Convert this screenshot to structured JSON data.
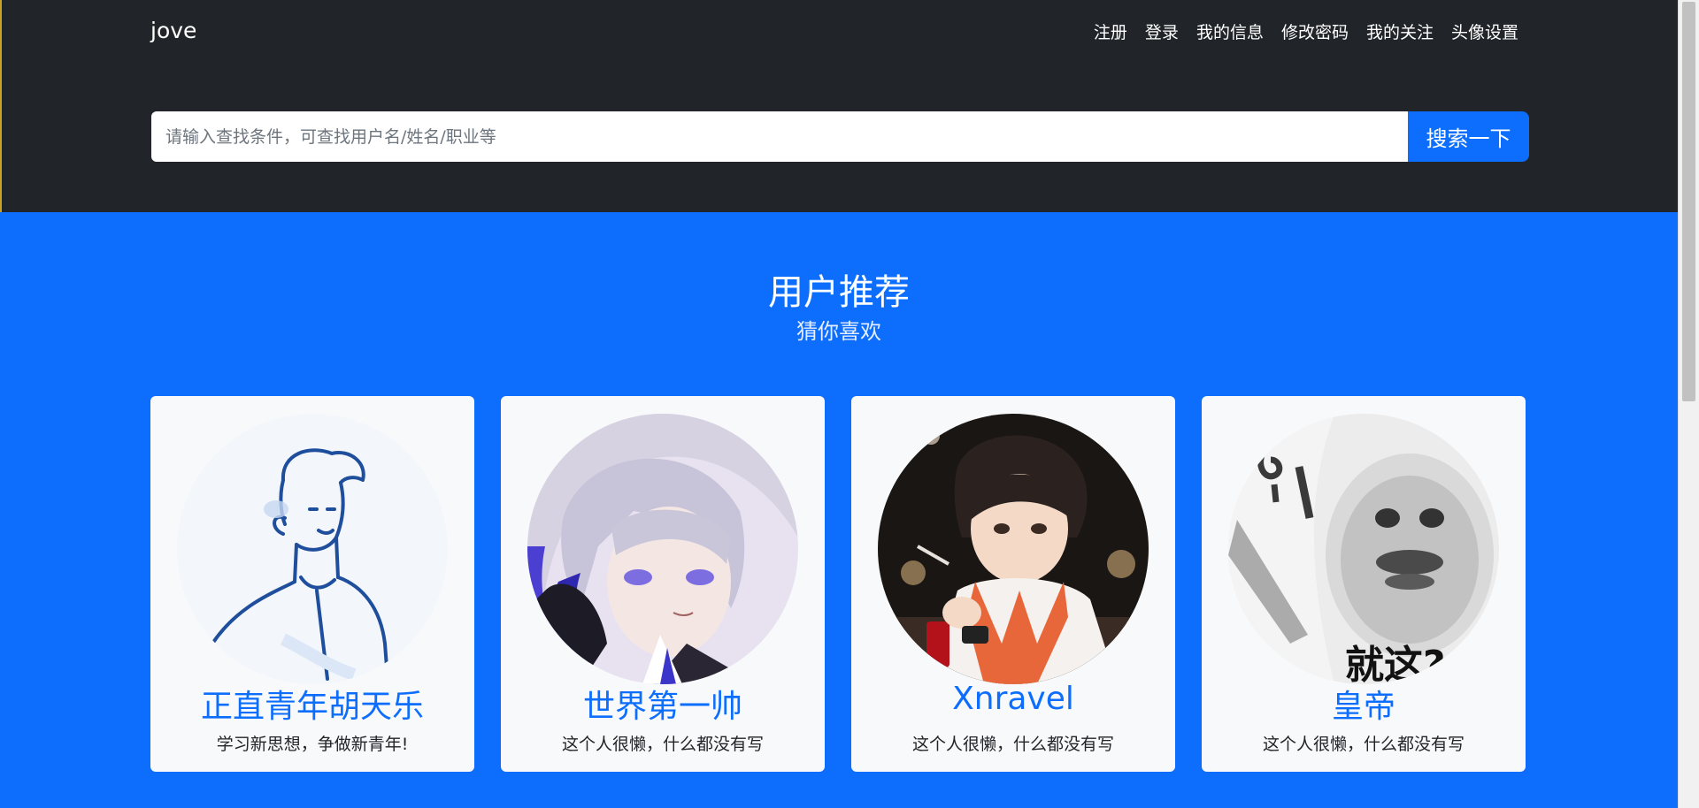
{
  "brand": "jove",
  "nav": {
    "register": "注册",
    "login": "登录",
    "my_info": "我的信息",
    "change_password": "修改密码",
    "my_follows": "我的关注",
    "avatar_settings": "头像设置"
  },
  "search": {
    "placeholder": "请输入查找条件，可查找用户名/姓名/职业等",
    "value": "",
    "button": "搜索一下"
  },
  "section": {
    "title": "用户推荐",
    "subtitle": "猜你喜欢"
  },
  "users": [
    {
      "name": "正直青年胡天乐",
      "bio": "学习新思想，争做新青年!",
      "avatar": "line-drawing-man-avatar"
    },
    {
      "name": "世界第一帅",
      "bio": "这个人很懒，什么都没有写",
      "avatar": "anime-silver-hair-avatar"
    },
    {
      "name": "Xnravel",
      "bio": "这个人很懒，什么都没有写",
      "avatar": "anime-orange-hoodie-avatar"
    },
    {
      "name": "皇帝",
      "bio": "这个人很懒，什么都没有写",
      "avatar": "meme-face-avatar",
      "avatar_caption": "就这?"
    }
  ],
  "colors": {
    "header_bg": "#212529",
    "primary": "#0d6efd",
    "card_bg": "#f8f9fa"
  }
}
